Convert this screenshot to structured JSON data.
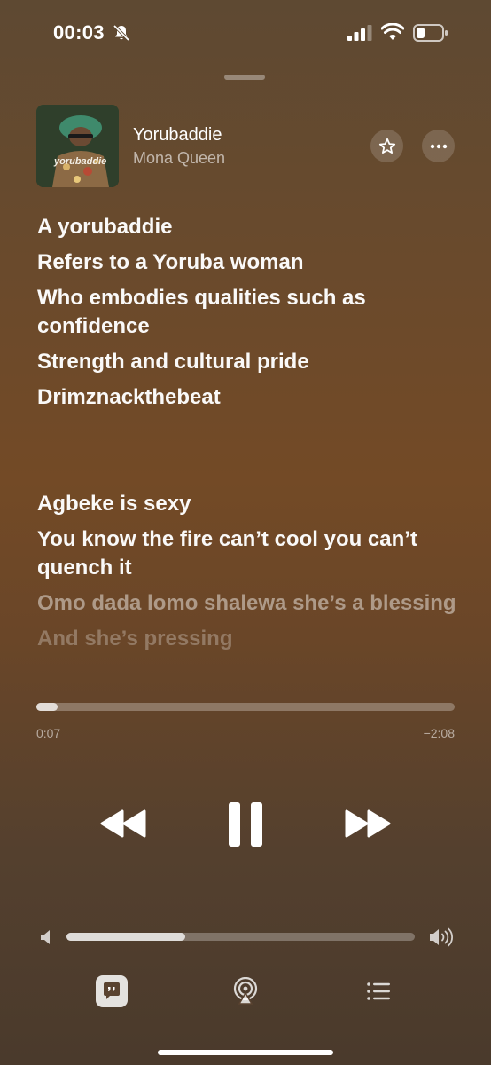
{
  "status_bar": {
    "time": "00:03",
    "icons": [
      "bell-slash-icon",
      "cellular-signal-icon",
      "wifi-icon",
      "battery-icon"
    ]
  },
  "now_playing": {
    "title": "Yorubaddie",
    "artist": "Mona Queen",
    "artwork_text": "yorubaddie",
    "favorite_icon": "star-icon",
    "more_icon": "ellipsis-icon"
  },
  "lyrics": [
    "A yorubaddie",
    "Refers to a Yoruba woman",
    "Who embodies qualities such as confidence",
    "Strength and cultural pride",
    "Drimznackthebeat",
    "Agbeke is sexy",
    "You know the fire can’t cool you can’t quench it",
    "Omo dada lomo shalewa she’s a blessing",
    "And she’s pressing"
  ],
  "playback": {
    "elapsed": "0:07",
    "remaining": "−2:08",
    "progress_fraction": 0.05,
    "state": "playing"
  },
  "volume": {
    "level_fraction": 0.34
  },
  "colors": {
    "background_top": "#5e4932",
    "background_mid": "#734a26",
    "background_bottom": "#4a3a2c",
    "foreground": "#ffffff"
  }
}
